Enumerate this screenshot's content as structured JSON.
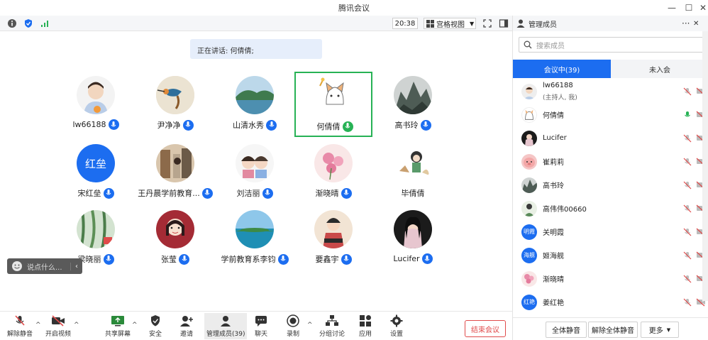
{
  "window": {
    "title": "腾讯会议"
  },
  "topbar": {
    "time": "20:38",
    "view_label": "宫格视图"
  },
  "speaking": {
    "text": "正在讲话: 何倩倩;"
  },
  "tiles": [
    {
      "name": "lw66188",
      "mic": "blue"
    },
    {
      "name": "尹净净",
      "mic": "blue"
    },
    {
      "name": "山清水秀",
      "mic": "blue"
    },
    {
      "name": "何倩倩",
      "mic": "green"
    },
    {
      "name": "高书玲",
      "mic": "blue"
    },
    {
      "name": "宋红垒",
      "mic": "blue",
      "avatar_text": "红垒"
    },
    {
      "name": "王丹晨学前教育...",
      "mic": "blue"
    },
    {
      "name": "刘洁丽",
      "mic": "blue"
    },
    {
      "name": "渐晓晴",
      "mic": "blue"
    },
    {
      "name": "毕倩倩",
      "mic": "none"
    },
    {
      "name": "梁晓丽",
      "mic": "blue"
    },
    {
      "name": "张莹",
      "mic": "blue"
    },
    {
      "name": "学前教育系李钧",
      "mic": "blue"
    },
    {
      "name": "要鑫宇",
      "mic": "blue"
    },
    {
      "name": "Lucifer",
      "mic": "blue"
    }
  ],
  "chat": {
    "placeholder": "说点什么..."
  },
  "toolbar": {
    "unmute": "解除静音",
    "video": "开启视频",
    "share": "共享屏幕",
    "security": "安全",
    "invite": "邀请",
    "members": "管理成员(39)",
    "chat": "聊天",
    "record": "录制",
    "breakout": "分组讨论",
    "apps": "应用",
    "settings": "设置",
    "end": "结束会议"
  },
  "panel": {
    "title": "管理成员",
    "search_placeholder": "搜索成员",
    "tab_in": "会议中(39)",
    "tab_out": "未入会",
    "members": [
      {
        "name": "lw66188",
        "sub": "(主持人, 我)",
        "mic": "muted"
      },
      {
        "name": "何倩倩",
        "sub": "",
        "mic": "on"
      },
      {
        "name": "Lucifer",
        "sub": "",
        "mic": "muted"
      },
      {
        "name": "崔莉莉",
        "sub": "",
        "mic": "muted"
      },
      {
        "name": "高书玲",
        "sub": "",
        "mic": "muted"
      },
      {
        "name": "高伟伟00660",
        "sub": "",
        "mic": "muted"
      },
      {
        "name": "关明霞",
        "sub": "",
        "mic": "muted",
        "avatar_text": "明霞"
      },
      {
        "name": "姬海舰",
        "sub": "",
        "mic": "muted",
        "avatar_text": "海舰"
      },
      {
        "name": "渐晓晴",
        "sub": "",
        "mic": "muted"
      },
      {
        "name": "姜红艳",
        "sub": "",
        "mic": "muted",
        "avatar_text": "红艳"
      }
    ],
    "mute_all": "全体静音",
    "unmute_all": "解除全体静音",
    "more": "更多"
  },
  "colors": {
    "accent": "#1c6df0",
    "speaking": "#27b255",
    "danger": "#e04b4b"
  }
}
